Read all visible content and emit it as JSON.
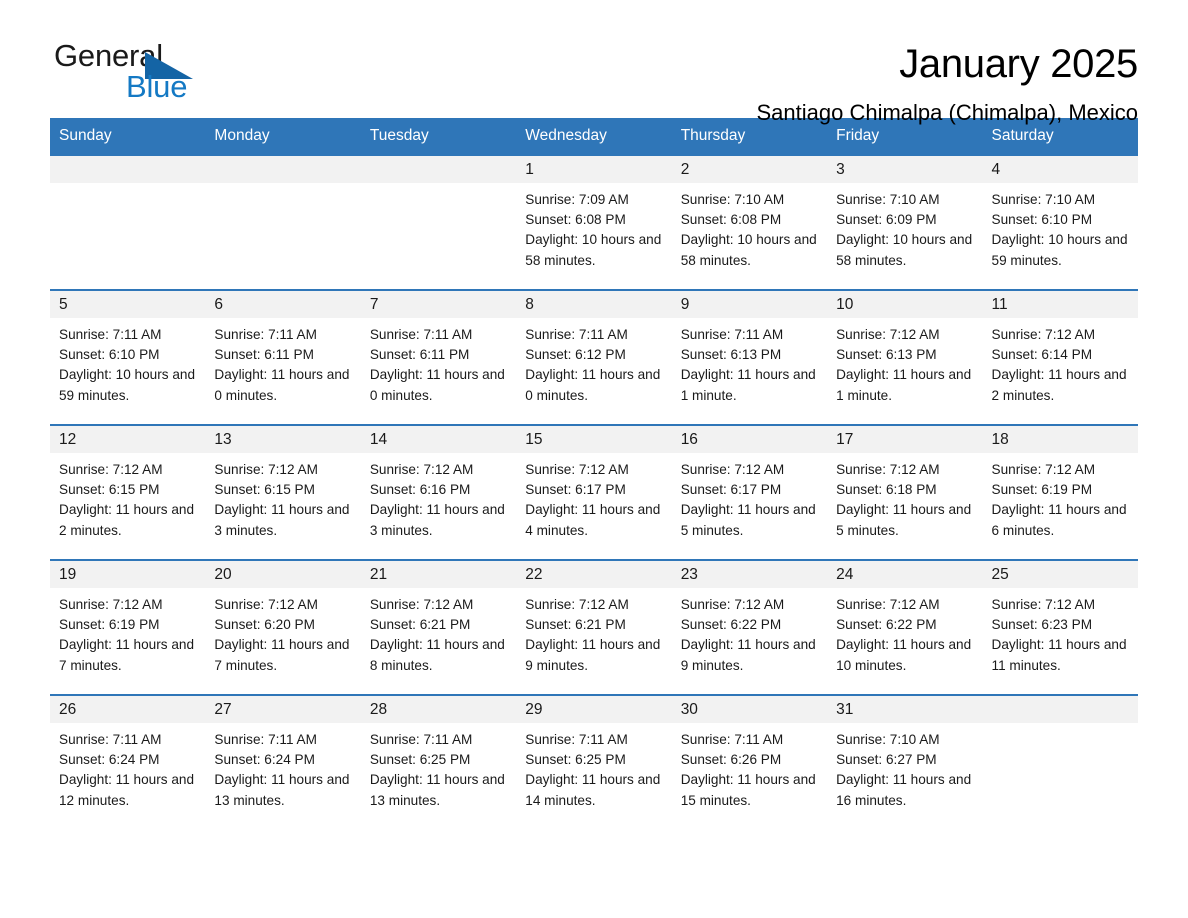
{
  "brand": {
    "name_primary": "General",
    "name_secondary": "Blue",
    "triangle_icon": "triangle-icon",
    "accent_color": "#1479c4"
  },
  "header": {
    "month_title": "January 2025",
    "location": "Santiago Chimalpa (Chimalpa), Mexico"
  },
  "colors": {
    "header_blue": "#2f76b8",
    "daynum_band": "#f2f2f2",
    "logo_black": "#1a1a1a",
    "logo_blue": "#1479c4"
  },
  "calendar": {
    "weekday_headers": [
      "Sunday",
      "Monday",
      "Tuesday",
      "Wednesday",
      "Thursday",
      "Friday",
      "Saturday"
    ],
    "weeks": [
      [
        {
          "day": "",
          "sunrise": "",
          "sunset": "",
          "daylight": ""
        },
        {
          "day": "",
          "sunrise": "",
          "sunset": "",
          "daylight": ""
        },
        {
          "day": "",
          "sunrise": "",
          "sunset": "",
          "daylight": ""
        },
        {
          "day": "1",
          "sunrise": "Sunrise: 7:09 AM",
          "sunset": "Sunset: 6:08 PM",
          "daylight": "Daylight: 10 hours and 58 minutes."
        },
        {
          "day": "2",
          "sunrise": "Sunrise: 7:10 AM",
          "sunset": "Sunset: 6:08 PM",
          "daylight": "Daylight: 10 hours and 58 minutes."
        },
        {
          "day": "3",
          "sunrise": "Sunrise: 7:10 AM",
          "sunset": "Sunset: 6:09 PM",
          "daylight": "Daylight: 10 hours and 58 minutes."
        },
        {
          "day": "4",
          "sunrise": "Sunrise: 7:10 AM",
          "sunset": "Sunset: 6:10 PM",
          "daylight": "Daylight: 10 hours and 59 minutes."
        }
      ],
      [
        {
          "day": "5",
          "sunrise": "Sunrise: 7:11 AM",
          "sunset": "Sunset: 6:10 PM",
          "daylight": "Daylight: 10 hours and 59 minutes."
        },
        {
          "day": "6",
          "sunrise": "Sunrise: 7:11 AM",
          "sunset": "Sunset: 6:11 PM",
          "daylight": "Daylight: 11 hours and 0 minutes."
        },
        {
          "day": "7",
          "sunrise": "Sunrise: 7:11 AM",
          "sunset": "Sunset: 6:11 PM",
          "daylight": "Daylight: 11 hours and 0 minutes."
        },
        {
          "day": "8",
          "sunrise": "Sunrise: 7:11 AM",
          "sunset": "Sunset: 6:12 PM",
          "daylight": "Daylight: 11 hours and 0 minutes."
        },
        {
          "day": "9",
          "sunrise": "Sunrise: 7:11 AM",
          "sunset": "Sunset: 6:13 PM",
          "daylight": "Daylight: 11 hours and 1 minute."
        },
        {
          "day": "10",
          "sunrise": "Sunrise: 7:12 AM",
          "sunset": "Sunset: 6:13 PM",
          "daylight": "Daylight: 11 hours and 1 minute."
        },
        {
          "day": "11",
          "sunrise": "Sunrise: 7:12 AM",
          "sunset": "Sunset: 6:14 PM",
          "daylight": "Daylight: 11 hours and 2 minutes."
        }
      ],
      [
        {
          "day": "12",
          "sunrise": "Sunrise: 7:12 AM",
          "sunset": "Sunset: 6:15 PM",
          "daylight": "Daylight: 11 hours and 2 minutes."
        },
        {
          "day": "13",
          "sunrise": "Sunrise: 7:12 AM",
          "sunset": "Sunset: 6:15 PM",
          "daylight": "Daylight: 11 hours and 3 minutes."
        },
        {
          "day": "14",
          "sunrise": "Sunrise: 7:12 AM",
          "sunset": "Sunset: 6:16 PM",
          "daylight": "Daylight: 11 hours and 3 minutes."
        },
        {
          "day": "15",
          "sunrise": "Sunrise: 7:12 AM",
          "sunset": "Sunset: 6:17 PM",
          "daylight": "Daylight: 11 hours and 4 minutes."
        },
        {
          "day": "16",
          "sunrise": "Sunrise: 7:12 AM",
          "sunset": "Sunset: 6:17 PM",
          "daylight": "Daylight: 11 hours and 5 minutes."
        },
        {
          "day": "17",
          "sunrise": "Sunrise: 7:12 AM",
          "sunset": "Sunset: 6:18 PM",
          "daylight": "Daylight: 11 hours and 5 minutes."
        },
        {
          "day": "18",
          "sunrise": "Sunrise: 7:12 AM",
          "sunset": "Sunset: 6:19 PM",
          "daylight": "Daylight: 11 hours and 6 minutes."
        }
      ],
      [
        {
          "day": "19",
          "sunrise": "Sunrise: 7:12 AM",
          "sunset": "Sunset: 6:19 PM",
          "daylight": "Daylight: 11 hours and 7 minutes."
        },
        {
          "day": "20",
          "sunrise": "Sunrise: 7:12 AM",
          "sunset": "Sunset: 6:20 PM",
          "daylight": "Daylight: 11 hours and 7 minutes."
        },
        {
          "day": "21",
          "sunrise": "Sunrise: 7:12 AM",
          "sunset": "Sunset: 6:21 PM",
          "daylight": "Daylight: 11 hours and 8 minutes."
        },
        {
          "day": "22",
          "sunrise": "Sunrise: 7:12 AM",
          "sunset": "Sunset: 6:21 PM",
          "daylight": "Daylight: 11 hours and 9 minutes."
        },
        {
          "day": "23",
          "sunrise": "Sunrise: 7:12 AM",
          "sunset": "Sunset: 6:22 PM",
          "daylight": "Daylight: 11 hours and 9 minutes."
        },
        {
          "day": "24",
          "sunrise": "Sunrise: 7:12 AM",
          "sunset": "Sunset: 6:22 PM",
          "daylight": "Daylight: 11 hours and 10 minutes."
        },
        {
          "day": "25",
          "sunrise": "Sunrise: 7:12 AM",
          "sunset": "Sunset: 6:23 PM",
          "daylight": "Daylight: 11 hours and 11 minutes."
        }
      ],
      [
        {
          "day": "26",
          "sunrise": "Sunrise: 7:11 AM",
          "sunset": "Sunset: 6:24 PM",
          "daylight": "Daylight: 11 hours and 12 minutes."
        },
        {
          "day": "27",
          "sunrise": "Sunrise: 7:11 AM",
          "sunset": "Sunset: 6:24 PM",
          "daylight": "Daylight: 11 hours and 13 minutes."
        },
        {
          "day": "28",
          "sunrise": "Sunrise: 7:11 AM",
          "sunset": "Sunset: 6:25 PM",
          "daylight": "Daylight: 11 hours and 13 minutes."
        },
        {
          "day": "29",
          "sunrise": "Sunrise: 7:11 AM",
          "sunset": "Sunset: 6:25 PM",
          "daylight": "Daylight: 11 hours and 14 minutes."
        },
        {
          "day": "30",
          "sunrise": "Sunrise: 7:11 AM",
          "sunset": "Sunset: 6:26 PM",
          "daylight": "Daylight: 11 hours and 15 minutes."
        },
        {
          "day": "31",
          "sunrise": "Sunrise: 7:10 AM",
          "sunset": "Sunset: 6:27 PM",
          "daylight": "Daylight: 11 hours and 16 minutes."
        },
        {
          "day": "",
          "sunrise": "",
          "sunset": "",
          "daylight": ""
        }
      ]
    ]
  }
}
